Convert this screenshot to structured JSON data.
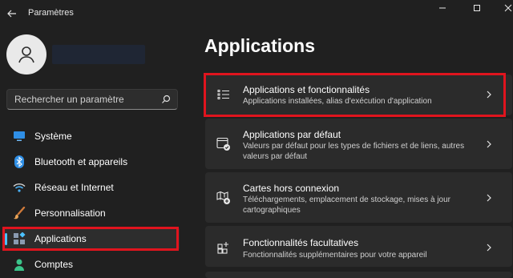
{
  "window": {
    "title": "Paramètres",
    "controls": [
      "minimize-icon",
      "maximize-icon",
      "close-icon"
    ]
  },
  "sidebar": {
    "search_placeholder": "Rechercher un paramètre",
    "items": [
      {
        "label": "Système",
        "icon": "monitor-icon",
        "selected": false
      },
      {
        "label": "Bluetooth et appareils",
        "icon": "bluetooth-icon",
        "selected": false
      },
      {
        "label": "Réseau et Internet",
        "icon": "wifi-icon",
        "selected": false
      },
      {
        "label": "Personnalisation",
        "icon": "brush-icon",
        "selected": false
      },
      {
        "label": "Applications",
        "icon": "apps-icon",
        "selected": true
      },
      {
        "label": "Comptes",
        "icon": "person-icon",
        "selected": false
      }
    ]
  },
  "main": {
    "title": "Applications",
    "cards": [
      {
        "title": "Applications et fonctionnalités",
        "desc": "Applications installées, alias d'exécution d'application",
        "icon": "list-icon"
      },
      {
        "title": "Applications par défaut",
        "desc": "Valeurs par défaut pour les types de fichiers et de liens, autres valeurs par défaut",
        "icon": "default-app-icon"
      },
      {
        "title": "Cartes hors connexion",
        "desc": "Téléchargements, emplacement de stockage, mises à jour cartographiques",
        "icon": "offline-map-icon"
      },
      {
        "title": "Fonctionnalités facultatives",
        "desc": "Fonctionnalités supplémentaires pour votre appareil",
        "icon": "grid-plus-icon"
      }
    ]
  },
  "colors": {
    "background": "#202020",
    "card": "#2b2b2b",
    "accent": "#4cc2ff",
    "highlight_box": "#e0141e"
  }
}
